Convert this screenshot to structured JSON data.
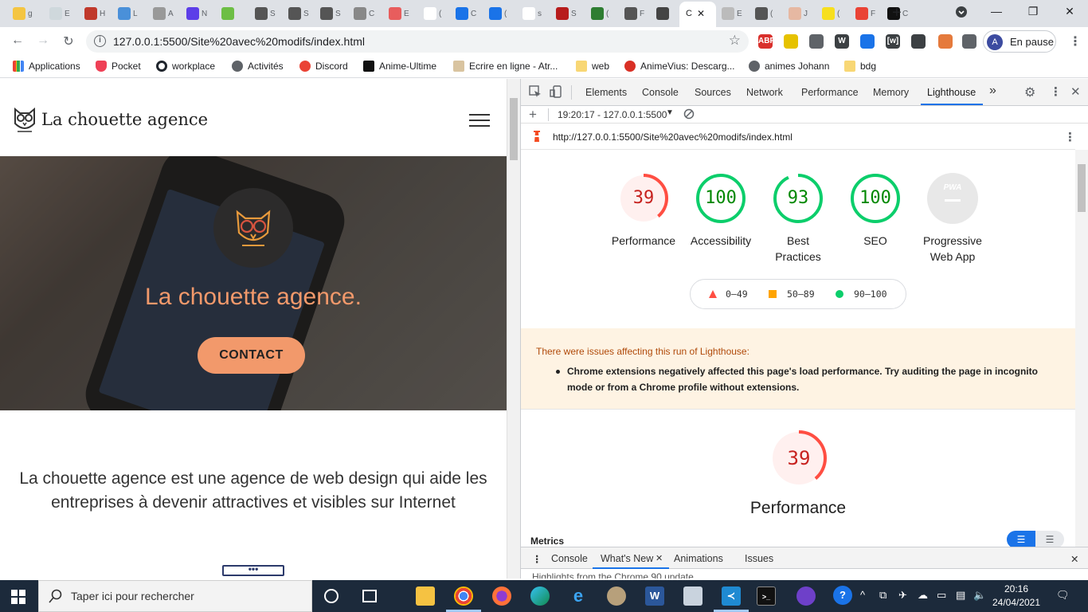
{
  "browser": {
    "tabs": [
      "g",
      "E",
      "H",
      "L",
      "A",
      "N",
      "",
      "S",
      "S",
      "S",
      "C",
      "E",
      "(",
      "C",
      "(",
      "s",
      "S",
      "(",
      "F",
      "",
      "C",
      "E",
      "(",
      "J",
      "(",
      "F",
      "C"
    ],
    "active_tab_index": 20,
    "new_tab_label": "+",
    "address_url": "127.0.0.1:5500/Site%20avec%20modifs/index.html",
    "profile_initial": "A",
    "profile_status": "En pause",
    "bookmarks": [
      "Applications",
      "Pocket",
      "workplace",
      "Activités",
      "Discord",
      "Anime-Ultime",
      "Ecrire en ligne - Atr...",
      "web",
      "AnimeVius: Descarg...",
      "animes Johann",
      "bdg"
    ],
    "extensions": [
      "ABP",
      "",
      "",
      "W",
      "",
      "[w]",
      "",
      "",
      ""
    ]
  },
  "site": {
    "brand_name": "La chouette agence",
    "hero_title": "La chouette agence.",
    "contact_label": "CONTACT",
    "intro_text": "La chouette agence est une agence de web design qui aide les entreprises à devenir attractives et visibles sur Internet",
    "dots_label": "•••",
    "accent_color": "#f2996b"
  },
  "devtools": {
    "tabs": [
      "Elements",
      "Console",
      "Sources",
      "Network",
      "Performance",
      "Memory",
      "Lighthouse"
    ],
    "active_tab": "Lighthouse",
    "more_tabs": "»",
    "report_selector": "19:20:17 - 127.0.0.1:5500",
    "report_url": "http://127.0.0.1:5500/Site%20avec%20modifs/index.html",
    "scores": [
      {
        "label": "Performance",
        "score": "39",
        "value": 39,
        "color": "#ff4e42",
        "bg": "#fff0ef"
      },
      {
        "label": "Accessibility",
        "score": "100",
        "value": 100,
        "color": "#0cce6b",
        "bg": "#ffffff"
      },
      {
        "label": "Best Practices",
        "score": "93",
        "value": 93,
        "color": "#0cce6b",
        "bg": "#ffffff"
      },
      {
        "label": "SEO",
        "score": "100",
        "value": 100,
        "color": "#0cce6b",
        "bg": "#ffffff"
      },
      {
        "label": "Progressive Web App",
        "score": "PWA",
        "value": 0,
        "color": "#9aa0a6",
        "bg": "#e8e8e8"
      }
    ],
    "legend": [
      {
        "range": "0–49",
        "color": "#ff4e42",
        "shape": "triangle"
      },
      {
        "range": "50–89",
        "color": "#ffa400",
        "shape": "square"
      },
      {
        "range": "90–100",
        "color": "#0cce6b",
        "shape": "circle"
      }
    ],
    "warning_heading": "There were issues affecting this run of Lighthouse:",
    "warning_item": "Chrome extensions negatively affected this page's load performance. Try auditing the page in incognito mode or from a Chrome profile without extensions.",
    "main_score": "39",
    "main_value": 39,
    "main_label": "Performance",
    "metrics_label": "Metrics",
    "drawer_tabs": [
      "Console",
      "What's New",
      "Animations",
      "Issues"
    ],
    "active_drawer_tab": "What's New",
    "drawer_text": "Highlights from the Chrome 90 update"
  },
  "taskbar": {
    "search_placeholder": "Taper ici pour rechercher",
    "time": "20:16",
    "date": "24/04/2021"
  }
}
